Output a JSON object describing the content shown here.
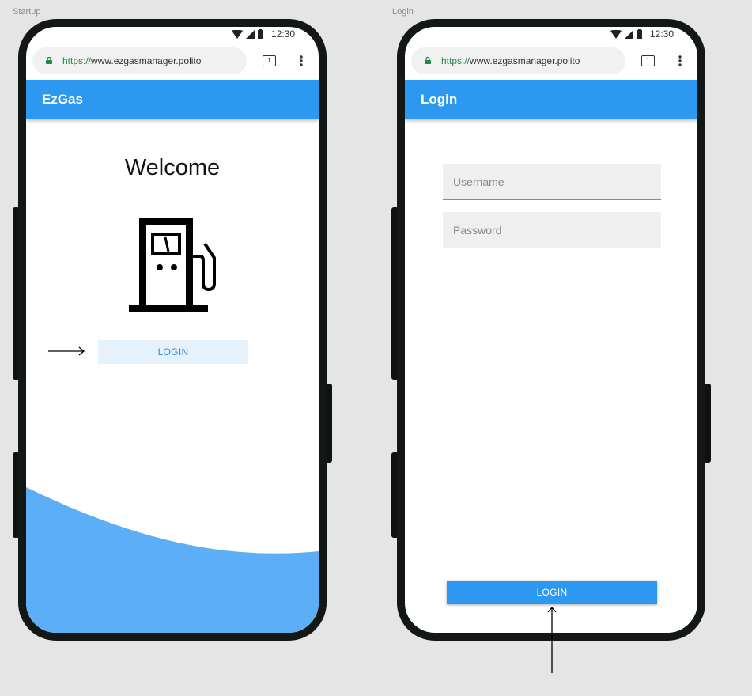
{
  "screens": {
    "startup": {
      "frame_label": "Startup",
      "status_time": "12:30",
      "url_scheme": "https://",
      "url_host": "www.ezgasmanager.polito",
      "tab_count": "1",
      "app_title": "EzGas",
      "welcome_text": "Welcome",
      "login_button": "LOGIN"
    },
    "login": {
      "frame_label": "Login",
      "status_time": "12:30",
      "url_scheme": "https://",
      "url_host": "www.ezgasmanager.polito",
      "tab_count": "1",
      "app_title": "Login",
      "username_placeholder": "Username",
      "password_placeholder": "Password",
      "login_button": "LOGIN"
    }
  },
  "icons": [
    "wifi-icon",
    "signal-icon",
    "battery-icon",
    "lock-icon",
    "tabs-icon",
    "menu-icon",
    "gas-pump-icon",
    "arrow-right-icon",
    "arrow-up-icon"
  ],
  "colors": {
    "primary": "#2d98ef",
    "wave": "#5caff7",
    "light_button": "#e5f1fb",
    "canvas": "#e5e5e5",
    "phone_bezel": "#131716",
    "url_secure": "#1e8e3e"
  }
}
